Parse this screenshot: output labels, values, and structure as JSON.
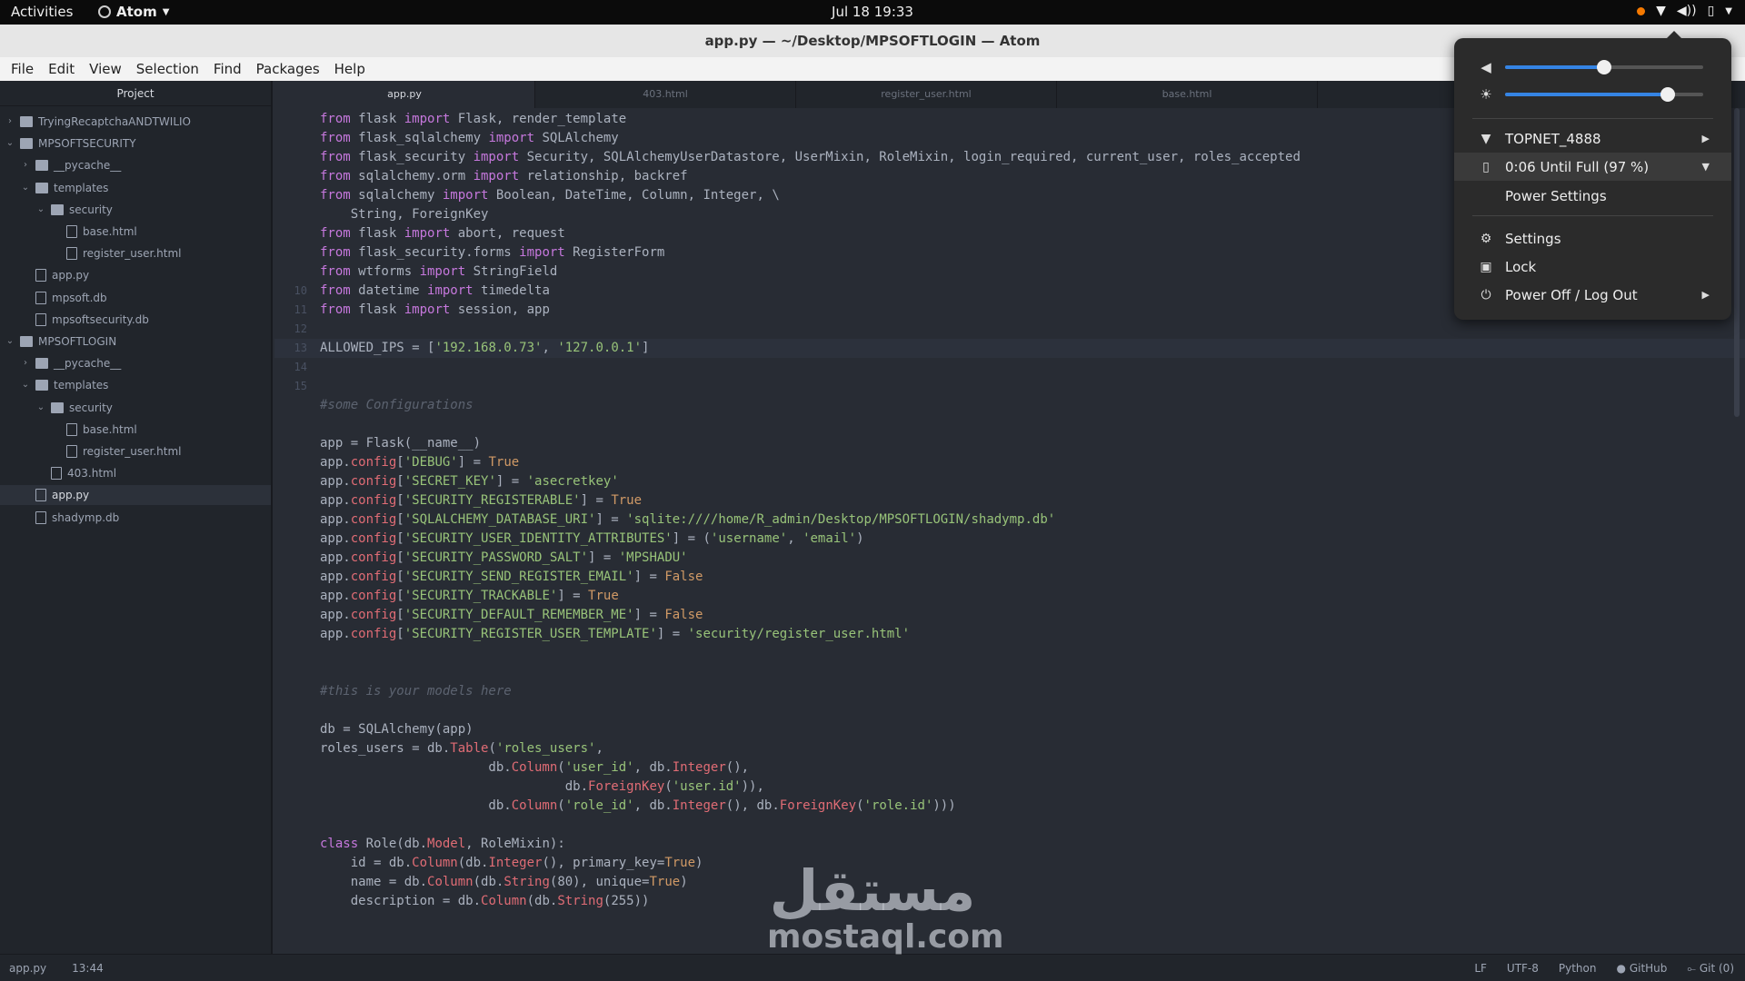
{
  "topbar": {
    "activities": "Activities",
    "app_name": "Atom",
    "clock": "Jul 18  19:33",
    "notification_color": "#f57900"
  },
  "window": {
    "title": "app.py — ~/Desktop/MPSOFTLOGIN — Atom"
  },
  "menu": [
    "File",
    "Edit",
    "View",
    "Selection",
    "Find",
    "Packages",
    "Help"
  ],
  "sidebar": {
    "title": "Project",
    "items": [
      {
        "label": "TryingRecaptchaANDTWILIO",
        "kind": "folder",
        "expanded": false,
        "depth": 0
      },
      {
        "label": "MPSOFTSECURITY",
        "kind": "folder",
        "expanded": true,
        "depth": 0
      },
      {
        "label": "__pycache__",
        "kind": "folder",
        "expanded": false,
        "depth": 1
      },
      {
        "label": "templates",
        "kind": "folder",
        "expanded": true,
        "depth": 1
      },
      {
        "label": "security",
        "kind": "folder",
        "expanded": true,
        "depth": 2
      },
      {
        "label": "base.html",
        "kind": "file",
        "depth": 3
      },
      {
        "label": "register_user.html",
        "kind": "file",
        "depth": 3
      },
      {
        "label": "app.py",
        "kind": "file",
        "depth": 1
      },
      {
        "label": "mpsoft.db",
        "kind": "file",
        "depth": 1
      },
      {
        "label": "mpsoftsecurity.db",
        "kind": "file",
        "depth": 1
      },
      {
        "label": "MPSOFTLOGIN",
        "kind": "folder",
        "expanded": true,
        "depth": 0
      },
      {
        "label": "__pycache__",
        "kind": "folder",
        "expanded": false,
        "depth": 1
      },
      {
        "label": "templates",
        "kind": "folder",
        "expanded": true,
        "depth": 1
      },
      {
        "label": "security",
        "kind": "folder",
        "expanded": true,
        "depth": 2
      },
      {
        "label": "base.html",
        "kind": "file",
        "depth": 3
      },
      {
        "label": "register_user.html",
        "kind": "file",
        "depth": 3
      },
      {
        "label": "403.html",
        "kind": "file",
        "depth": 2
      },
      {
        "label": "app.py",
        "kind": "file",
        "depth": 1,
        "selected": true
      },
      {
        "label": "shadymp.db",
        "kind": "file",
        "depth": 1
      }
    ]
  },
  "tabs": [
    {
      "label": "app.py",
      "active": true
    },
    {
      "label": "403.html",
      "active": false
    },
    {
      "label": "register_user.html",
      "active": false
    },
    {
      "label": "base.html",
      "active": false
    }
  ],
  "editor": {
    "current_line": 13,
    "lines": [
      {
        "n": "",
        "text": "from flask import Flask, render_template"
      },
      {
        "n": "",
        "text": "from flask_sqlalchemy import SQLAlchemy"
      },
      {
        "n": "",
        "text": "from flask_security import Security, SQLAlchemyUserDatastore, UserMixin, RoleMixin, login_required, current_user, roles_accepted"
      },
      {
        "n": "",
        "text": "from sqlalchemy.orm import relationship, backref"
      },
      {
        "n": "",
        "text": "from sqlalchemy import Boolean, DateTime, Column, Integer, \\"
      },
      {
        "n": "",
        "text": "    String, ForeignKey"
      },
      {
        "n": "",
        "text": "from flask import abort, request"
      },
      {
        "n": "",
        "text": "from flask_security.forms import RegisterForm"
      },
      {
        "n": "",
        "text": "from wtforms import StringField"
      },
      {
        "n": "10",
        "text": "from datetime import timedelta"
      },
      {
        "n": "11",
        "text": "from flask import session, app"
      },
      {
        "n": "12",
        "text": ""
      },
      {
        "n": "13",
        "text": "ALLOWED_IPS = ['192.168.0.73', '127.0.0.1']"
      },
      {
        "n": "14",
        "text": ""
      },
      {
        "n": "15",
        "text": ""
      },
      {
        "n": "",
        "text": "#some Configurations"
      },
      {
        "n": "",
        "text": ""
      },
      {
        "n": "",
        "text": "app = Flask(__name__)"
      },
      {
        "n": "",
        "text": "app.config['DEBUG'] = True"
      },
      {
        "n": "",
        "text": "app.config['SECRET_KEY'] = 'asecretkey'"
      },
      {
        "n": "",
        "text": "app.config['SECURITY_REGISTERABLE'] = True"
      },
      {
        "n": "",
        "text": "app.config['SQLALCHEMY_DATABASE_URI'] = 'sqlite:////home/R_admin/Desktop/MPSOFTLOGIN/shadymp.db'"
      },
      {
        "n": "",
        "text": "app.config['SECURITY_USER_IDENTITY_ATTRIBUTES'] = ('username', 'email')"
      },
      {
        "n": "",
        "text": "app.config['SECURITY_PASSWORD_SALT'] = 'MPSHADU'"
      },
      {
        "n": "",
        "text": "app.config['SECURITY_SEND_REGISTER_EMAIL'] = False"
      },
      {
        "n": "",
        "text": "app.config['SECURITY_TRACKABLE'] = True"
      },
      {
        "n": "",
        "text": "app.config['SECURITY_DEFAULT_REMEMBER_ME'] = False"
      },
      {
        "n": "",
        "text": "app.config['SECURITY_REGISTER_USER_TEMPLATE'] = 'security/register_user.html'"
      },
      {
        "n": "",
        "text": ""
      },
      {
        "n": "",
        "text": ""
      },
      {
        "n": "",
        "text": "#this is your models here"
      },
      {
        "n": "",
        "text": ""
      },
      {
        "n": "",
        "text": "db = SQLAlchemy(app)"
      },
      {
        "n": "",
        "text": "roles_users = db.Table('roles_users',"
      },
      {
        "n": "",
        "text": "                      db.Column('user_id', db.Integer(),"
      },
      {
        "n": "",
        "text": "                                db.ForeignKey('user.id')),"
      },
      {
        "n": "",
        "text": "                      db.Column('role_id', db.Integer(), db.ForeignKey('role.id')))"
      },
      {
        "n": "",
        "text": ""
      },
      {
        "n": "",
        "text": "class Role(db.Model, RoleMixin):"
      },
      {
        "n": "",
        "text": "    id = db.Column(db.Integer(), primary_key=True)"
      },
      {
        "n": "",
        "text": "    name = db.Column(db.String(80), unique=True)"
      },
      {
        "n": "",
        "text": "    description = db.Column(db.String(255))"
      },
      {
        "n": "",
        "text": ""
      },
      {
        "n": "",
        "text": ""
      }
    ]
  },
  "statusbar": {
    "file": "app.py",
    "cursor": "13:44",
    "line_ending": "LF",
    "encoding": "UTF-8",
    "grammar": "Python",
    "github": "GitHub",
    "git": "Git (0)"
  },
  "system_menu": {
    "volume_level": 0.5,
    "brightness_level": 0.82,
    "accent": "#3584e4",
    "wifi": "TOPNET_4888",
    "battery": "0:06 Until Full (97 %)",
    "power_settings": "Power Settings",
    "settings": "Settings",
    "lock": "Lock",
    "power_off": "Power Off / Log Out"
  },
  "watermark": {
    "arabic": "مستقل",
    "latin": "mostaql.com"
  }
}
